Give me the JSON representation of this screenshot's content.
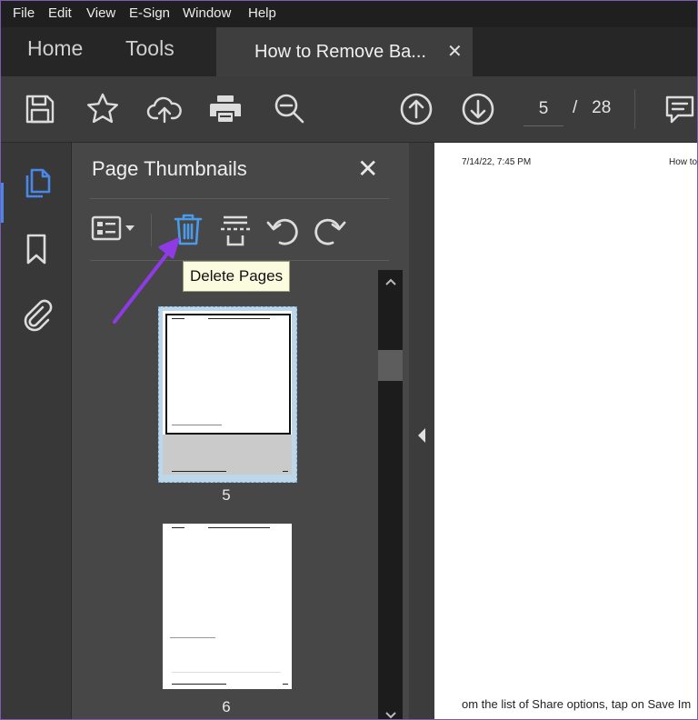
{
  "menu": [
    "File",
    "Edit",
    "View",
    "E-Sign",
    "Window",
    "Help"
  ],
  "tabs": {
    "home": "Home",
    "tools": "Tools",
    "document": "How to Remove Ba..."
  },
  "toolbar": {
    "current_page": "5",
    "page_sep": "/",
    "total_pages": "28"
  },
  "panel": {
    "title": "Page Thumbnails",
    "tooltip": "Delete Pages",
    "thumbnails": [
      {
        "page": "5",
        "selected": true
      },
      {
        "page": "6",
        "selected": false
      }
    ]
  },
  "document": {
    "header_date": "7/14/22, 7:45 PM",
    "header_title": "How to",
    "body_text": "om the list of Share options, tap on Save Im"
  },
  "colors": {
    "accent": "#4a88e8",
    "arrow": "#8e3be6",
    "tooltip_bg": "#fbfbe0",
    "selection": "#bcd6ea"
  },
  "icons": [
    "save-icon",
    "star-icon",
    "upload-cloud-icon",
    "print-icon",
    "zoom-out-icon",
    "page-up-icon",
    "page-down-icon",
    "comment-icon",
    "pages-icon",
    "bookmark-icon",
    "attachment-icon",
    "options-icon",
    "delete-icon",
    "extract-icon",
    "rotate-left-icon",
    "rotate-right-icon",
    "close-icon",
    "scroll-up-icon",
    "scroll-down-icon",
    "collapse-left-icon"
  ]
}
